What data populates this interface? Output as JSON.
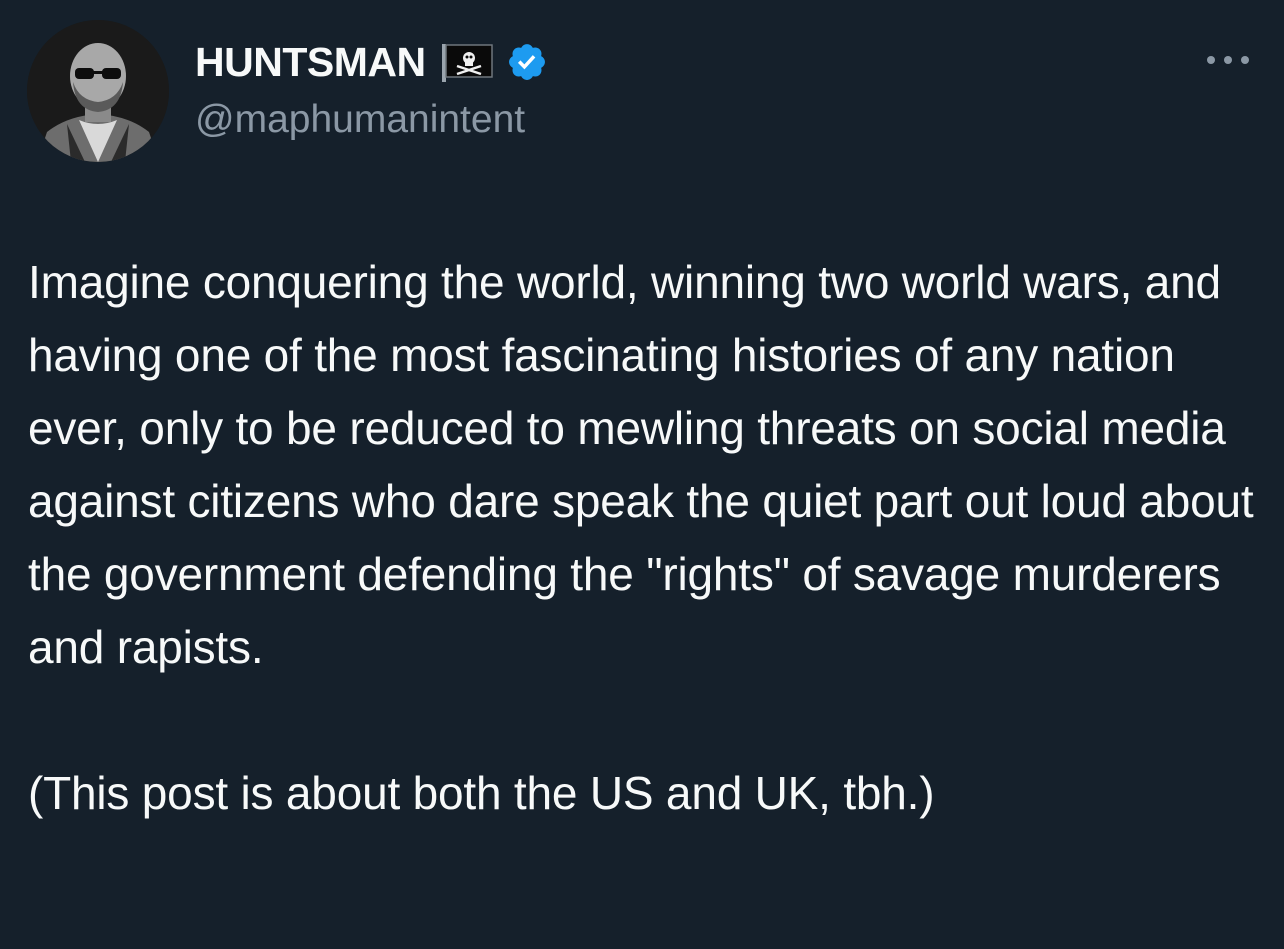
{
  "author": {
    "display_name": "HUNTSMAN",
    "handle": "@maphumanintent",
    "badges": [
      "pirate-flag-icon",
      "verified-icon"
    ],
    "verified_color": "#1d9bf0"
  },
  "tweet": {
    "paragraphs": [
      "Imagine conquering the world, winning two world wars, and having one of the most fascinating histories of any nation ever, only to be reduced to mewling threats on social media against citizens who dare speak the quiet part out loud about the government defending the \"rights\" of savage murderers and rapists.",
      "(This post is about both the US and UK, tbh.)"
    ]
  },
  "menu": {
    "icon": "more-options-icon"
  },
  "colors": {
    "background": "#15202b",
    "text": "#f7f9f9",
    "secondary_text": "#8b98a5"
  }
}
